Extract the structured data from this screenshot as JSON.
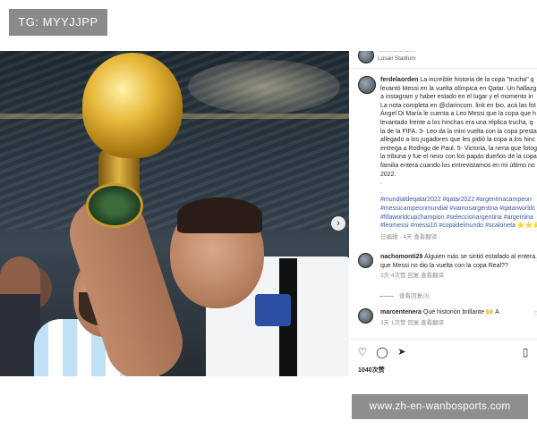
{
  "tag_label": "TG: MYYJJPP",
  "watermark": "www.zh-en-wanbosports.com",
  "post": {
    "location_header": {
      "username": "ferdelaorden",
      "place": "Lusail Stadium"
    },
    "caption": {
      "username": "ferdelaorden",
      "lines": [
        "La increíble historia de la copa \"trucha\" q",
        "levantó Messi en la vuelta olímpica en Qatar. Un hallazg",
        "a instagram y haber estado en el lugar y el momento in",
        "La nota completa en @clarincom. link en bio, acá las fot",
        "Ángel Di María le cuenta a Leo Messi que la copa que h",
        "levantado frente a los hinchas era una réplica trucha, q",
        "la de la FIFA. 3- Leo da la mini vuelta con la copa presta",
        "allegado a los jugadores que les pidió la copa a los hinc",
        "entrega a Rodrigo de Paul. 5- Victoria, la nena que fotog",
        "la tribuna y fue el nexo con los papás dueños de la copa",
        "familia entera cuando los entrevistamos en mi último no",
        "2022.",
        ".",
        "."
      ],
      "hashtags": [
        "#mundialdeqatar2022 #qatar2022 #argentinacampeon",
        "#messicampeonmundial #vamosargentina #qatarworldc",
        "#fifaworldcupchampion #seleccionargentina #argentina",
        "#leomessi #messi10 #copadelmundo #scaloneta ⭐⭐⭐"
      ],
      "meta": "已编辑 · 4天  查看翻译"
    },
    "comments": [
      {
        "username": "nachomonti29",
        "lines": [
          "Alguien más se sintió estafado al entera",
          "que Messi no dio la vuelta con la copa Real??"
        ],
        "meta": "3天  4次赞  回复  查看翻译",
        "view_replies": "查看回复(3)"
      },
      {
        "username": "marcentenera",
        "lines": [
          "Qué historión brillante 🙌 A"
        ],
        "meta": "3天  1次赞  回复  查看翻译"
      }
    ],
    "likes": "1040次赞"
  }
}
